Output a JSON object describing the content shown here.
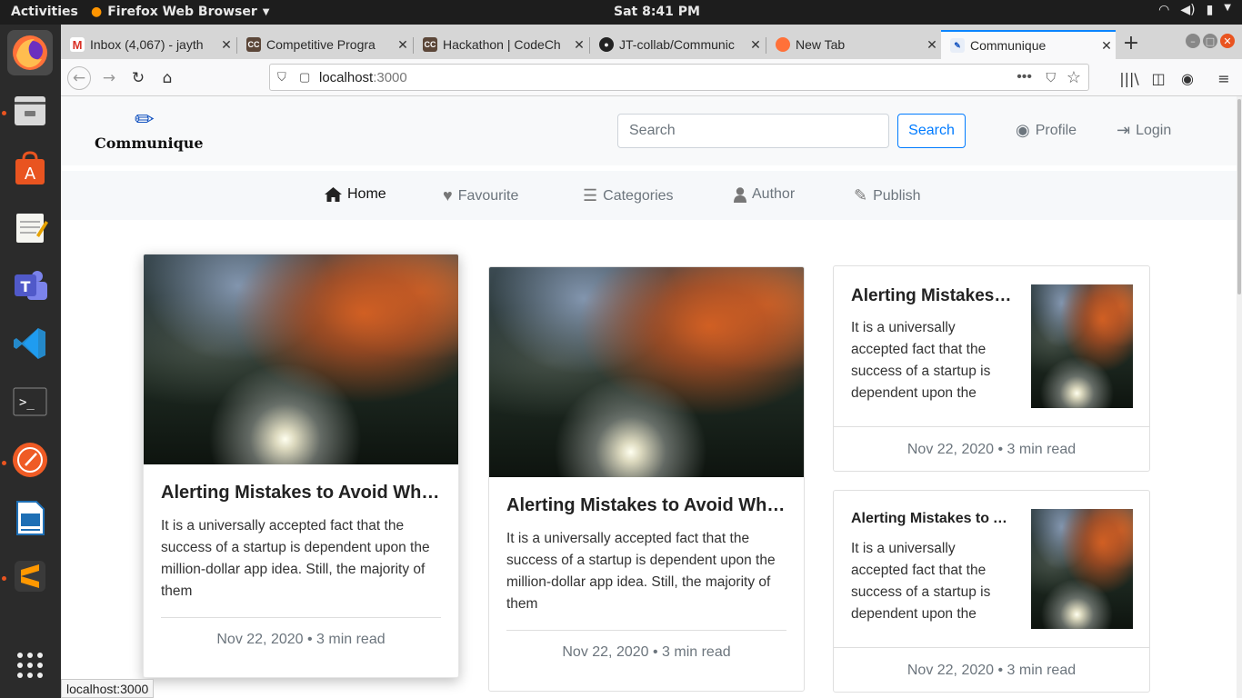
{
  "topbar": {
    "activities": "Activities",
    "app_menu": "Firefox Web Browser",
    "clock": "Sat  8:41 PM"
  },
  "tabs": [
    {
      "title": "Inbox (4,067) - jayth",
      "favicon": "gmail-icon"
    },
    {
      "title": "Competitive Progra",
      "favicon": "codechef-icon"
    },
    {
      "title": "Hackathon | CodeCh",
      "favicon": "codechef-icon"
    },
    {
      "title": "JT-collab/Communic",
      "favicon": "github-icon"
    },
    {
      "title": "New Tab",
      "favicon": "firefox-icon"
    },
    {
      "title": "Communique",
      "favicon": "communique-icon",
      "selected": true
    }
  ],
  "urlbar": {
    "host": "localhost",
    "port": ":3000"
  },
  "header": {
    "brand": "Communique",
    "search_placeholder": "Search",
    "search_button": "Search",
    "profile": "Profile",
    "login": "Login"
  },
  "nav": {
    "home": "Home",
    "favourite": "Favourite",
    "categories": "Categories",
    "author": "Author",
    "publish": "Publish"
  },
  "cards": [
    {
      "title": "Alerting Mistakes to Avoid While Developing a Startup App",
      "excerpt": "It is a universally accepted fact that the success of a startup is dependent upon the million-dollar app idea. Still, the majority of them",
      "meta": "Nov 22, 2020 • 3 min read"
    },
    {
      "title": "Alerting Mistakes to Avoid While Developing a Startup App",
      "excerpt": "It is a universally accepted fact that the success of a startup is dependent upon the million-dollar app idea. Still, the majority of them",
      "meta": "Nov 22, 2020 • 3 min read"
    },
    {
      "title": "Alerting Mistakes to Avoid",
      "excerpt": "It is a universally accepted fact that the success of a startup is dependent upon the",
      "meta": "Nov 22, 2020 • 3 min read"
    },
    {
      "title": "Alerting Mistakes to Avoid",
      "excerpt": "It is a universally accepted fact that the success of a startup is dependent upon the",
      "meta": "Nov 22, 2020 • 3 min read"
    }
  ],
  "status_url": "localhost:3000",
  "colors": {
    "accent": "#007bff",
    "brand_pen": "#1554c0",
    "ubuntu_orange": "#e95420"
  }
}
